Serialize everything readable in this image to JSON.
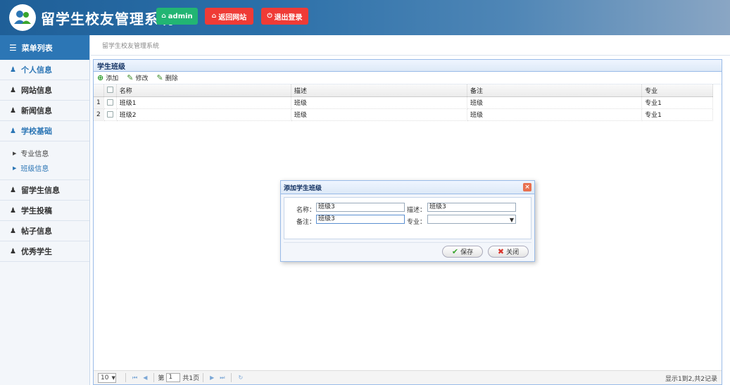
{
  "header": {
    "title": "留学生校友管理系统",
    "admin_label": "admin",
    "return_label": "返回网站",
    "logout_label": "退出登录"
  },
  "sidebar": {
    "menu_title": "菜单列表",
    "items": [
      {
        "label": "个人信息"
      },
      {
        "label": "网站信息"
      },
      {
        "label": "新闻信息"
      },
      {
        "label": "学校基础"
      },
      {
        "label": "留学生信息"
      },
      {
        "label": "学生投稿"
      },
      {
        "label": "帖子信息"
      },
      {
        "label": "优秀学生"
      }
    ],
    "sub_items": [
      {
        "label": "专业信息"
      },
      {
        "label": "班级信息"
      }
    ]
  },
  "breadcrumb": "留学生校友管理系统",
  "panel": {
    "title": "学生班级",
    "toolbar": {
      "add": "添加",
      "edit": "修改",
      "delete": "删除"
    },
    "columns": [
      "名称",
      "描述",
      "备注",
      "专业"
    ],
    "rows": [
      {
        "num": "1",
        "name": "班级1",
        "desc": "班级",
        "note": "班级",
        "major": "专业1"
      },
      {
        "num": "2",
        "name": "班级2",
        "desc": "班级",
        "note": "班级",
        "major": "专业1"
      }
    ]
  },
  "pager": {
    "page_size": "10",
    "page_prefix": "第",
    "page_value": "1",
    "page_suffix": "共1页",
    "info": "显示1到2,共2记录"
  },
  "dialog": {
    "title": "添加学生班级",
    "name_label": "名称：",
    "name_value": "班级3",
    "desc_label": "描述：",
    "desc_value": "班级3",
    "note_label": "备注：",
    "note_value": "班级3",
    "major_label": "专业：",
    "major_value": "",
    "save_label": "保存",
    "close_label": "关闭"
  },
  "colors": {
    "header_blue": "#1f5f98",
    "admin_green": "#22b573",
    "red_button": "#ef3b36",
    "sidebar_active": "#2c76b5"
  }
}
